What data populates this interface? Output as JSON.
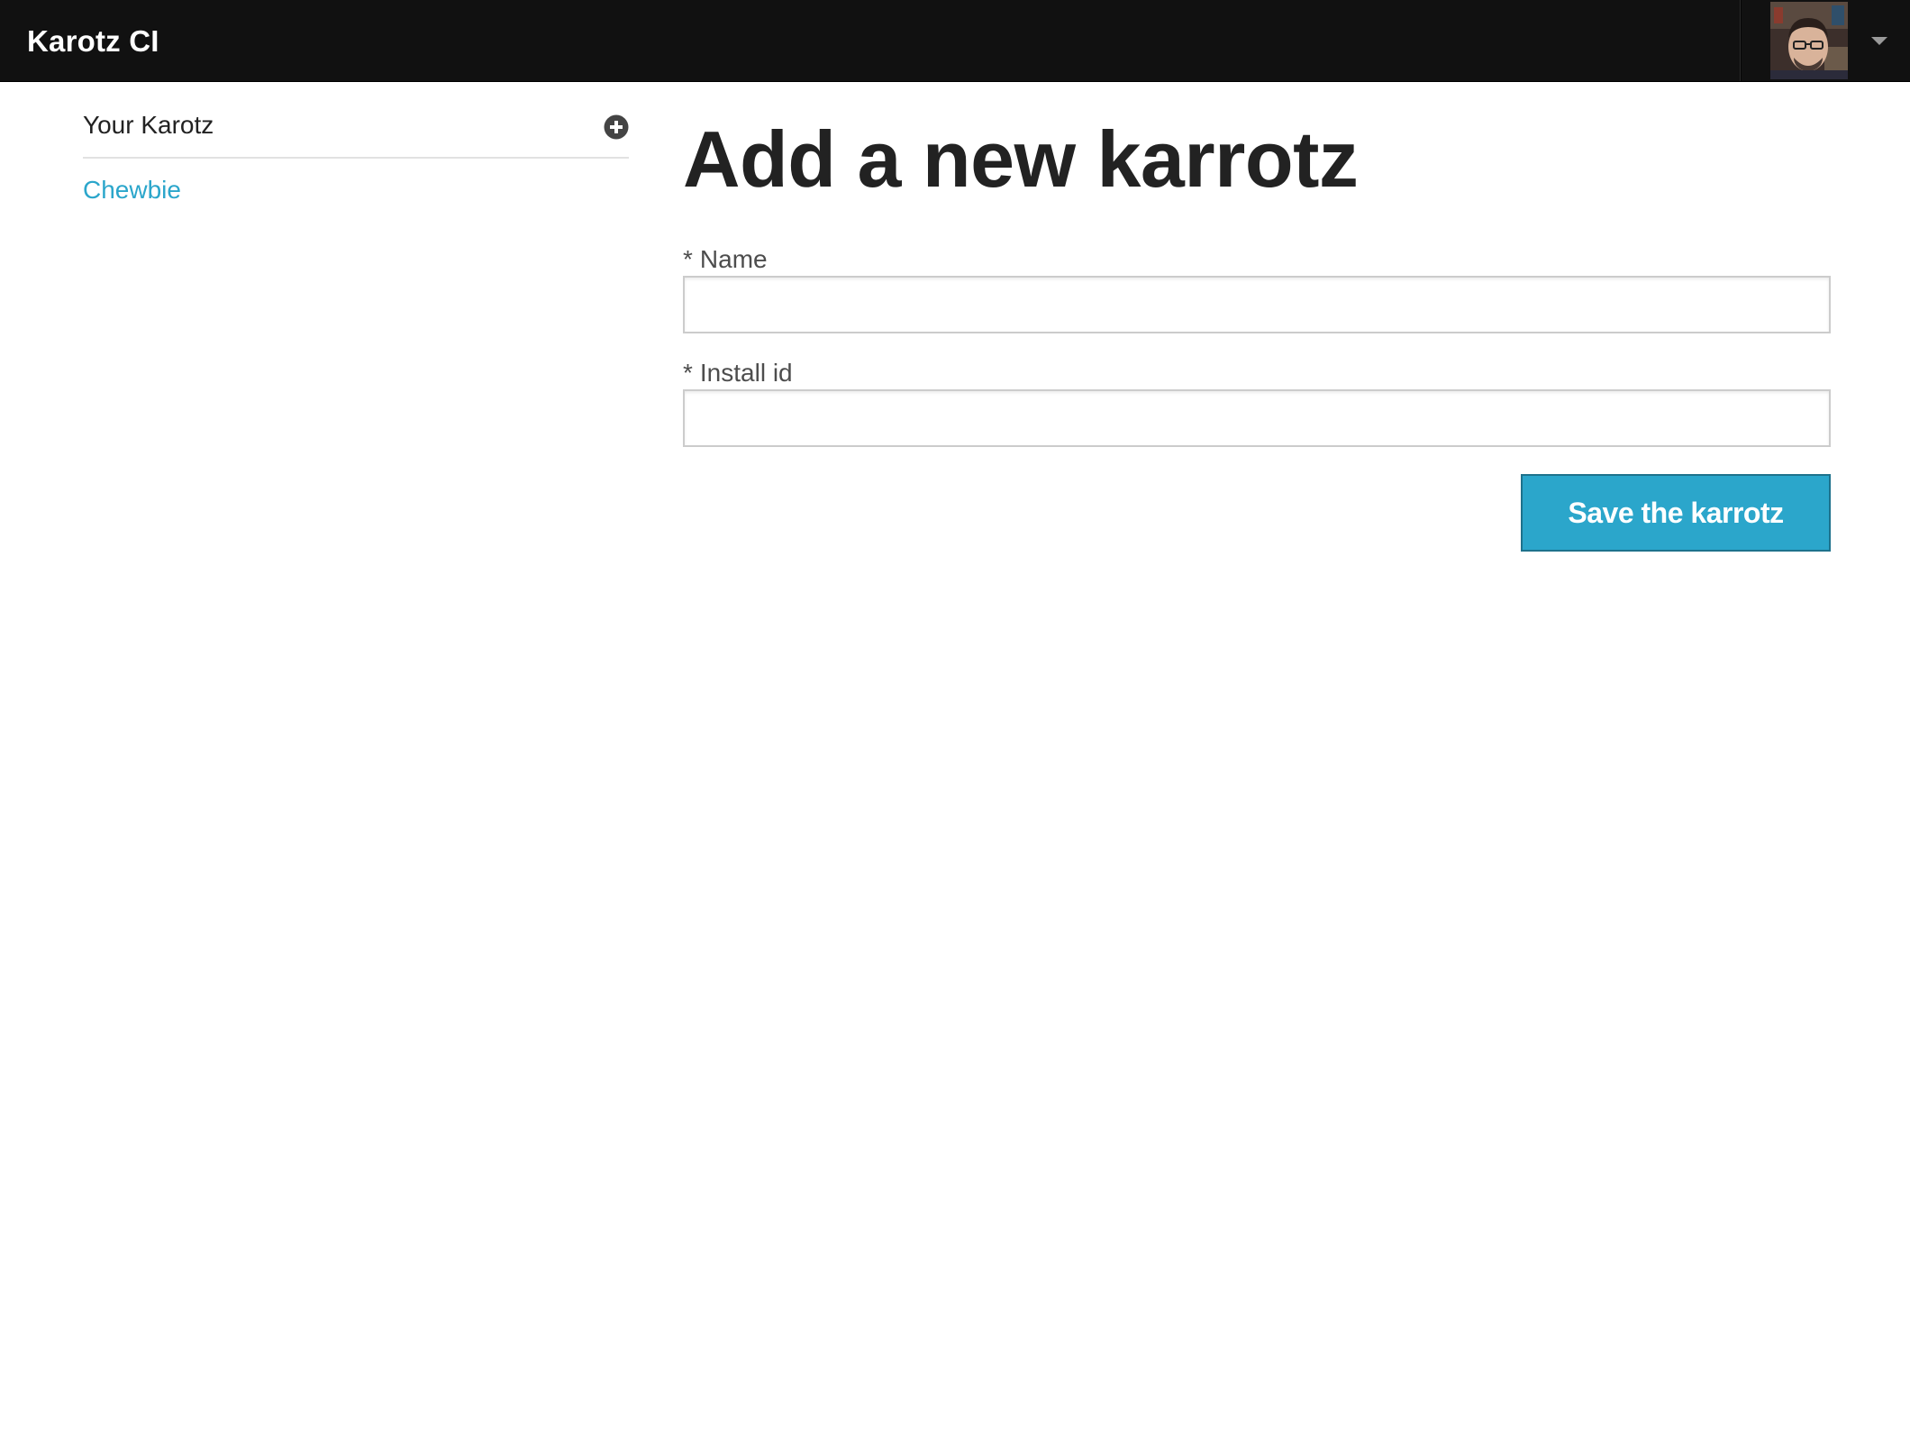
{
  "topbar": {
    "brand": "Karotz CI",
    "user_menu": {
      "avatar_icon": "user-avatar",
      "dropdown_icon": "caret-down-icon"
    }
  },
  "sidebar": {
    "title": "Your Karotz",
    "add_icon": "plus-circle-icon",
    "items": [
      {
        "label": "Chewbie"
      }
    ]
  },
  "main": {
    "title": "Add a new karrotz",
    "form": {
      "name_label": "Name",
      "name_value": "",
      "install_id_label": "Install id",
      "install_id_value": "",
      "required_marker": "*",
      "submit_label": "Save the karrotz"
    }
  },
  "colors": {
    "topbar_bg": "#111111",
    "link": "#2ba6cb",
    "button_bg": "#2ba6cb",
    "button_border": "#1e728c",
    "heading": "#222222"
  }
}
